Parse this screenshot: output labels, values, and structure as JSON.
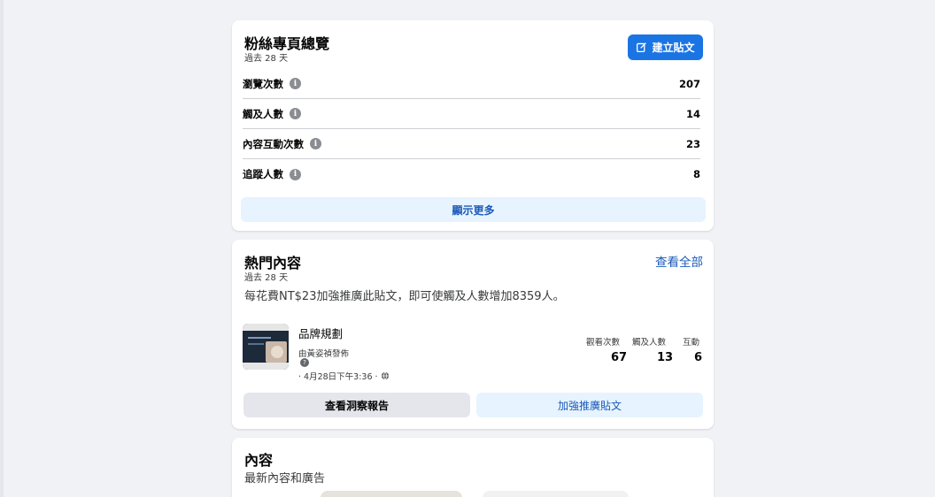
{
  "overview": {
    "title": "粉絲專頁總覽",
    "period": "過去 28 天",
    "create_post_label": "建立貼文",
    "metrics": [
      {
        "label": "瀏覽次數",
        "value": "207"
      },
      {
        "label": "觸及人數",
        "value": "14"
      },
      {
        "label": "內容互動次數",
        "value": "23"
      },
      {
        "label": "追蹤人數",
        "value": "8"
      }
    ],
    "show_more_label": "顯示更多"
  },
  "popular": {
    "title": "熱門內容",
    "period": "過去 28 天",
    "see_all_label": "查看全部",
    "promo_note": "每花費NT$23加強推廣此貼文，即可使觸及人數增加8359人。",
    "post": {
      "title": "品牌規劃",
      "author": "由黃姿禎發佈",
      "help_glyph": "?",
      "time": "· 4月28日下午3:36 ·"
    },
    "stats": [
      {
        "label": "觀看次數",
        "value": "67"
      },
      {
        "label": "觸及人數",
        "value": "13"
      },
      {
        "label": "互動",
        "value": "6"
      }
    ],
    "insights_label": "查看洞察報告",
    "boost_label": "加強推廣貼文"
  },
  "content": {
    "title": "內容",
    "subtitle": "最新內容和廣告"
  },
  "icons": {
    "edit": "edit-icon",
    "info": "info-icon",
    "globe": "globe-icon",
    "help": "question-icon"
  },
  "colors": {
    "accent": "#1b74e4",
    "link": "#1b5ab8",
    "light_blue": "#e7f3ff",
    "gray_button": "#e4e6eb",
    "background": "#f0f2f5"
  }
}
